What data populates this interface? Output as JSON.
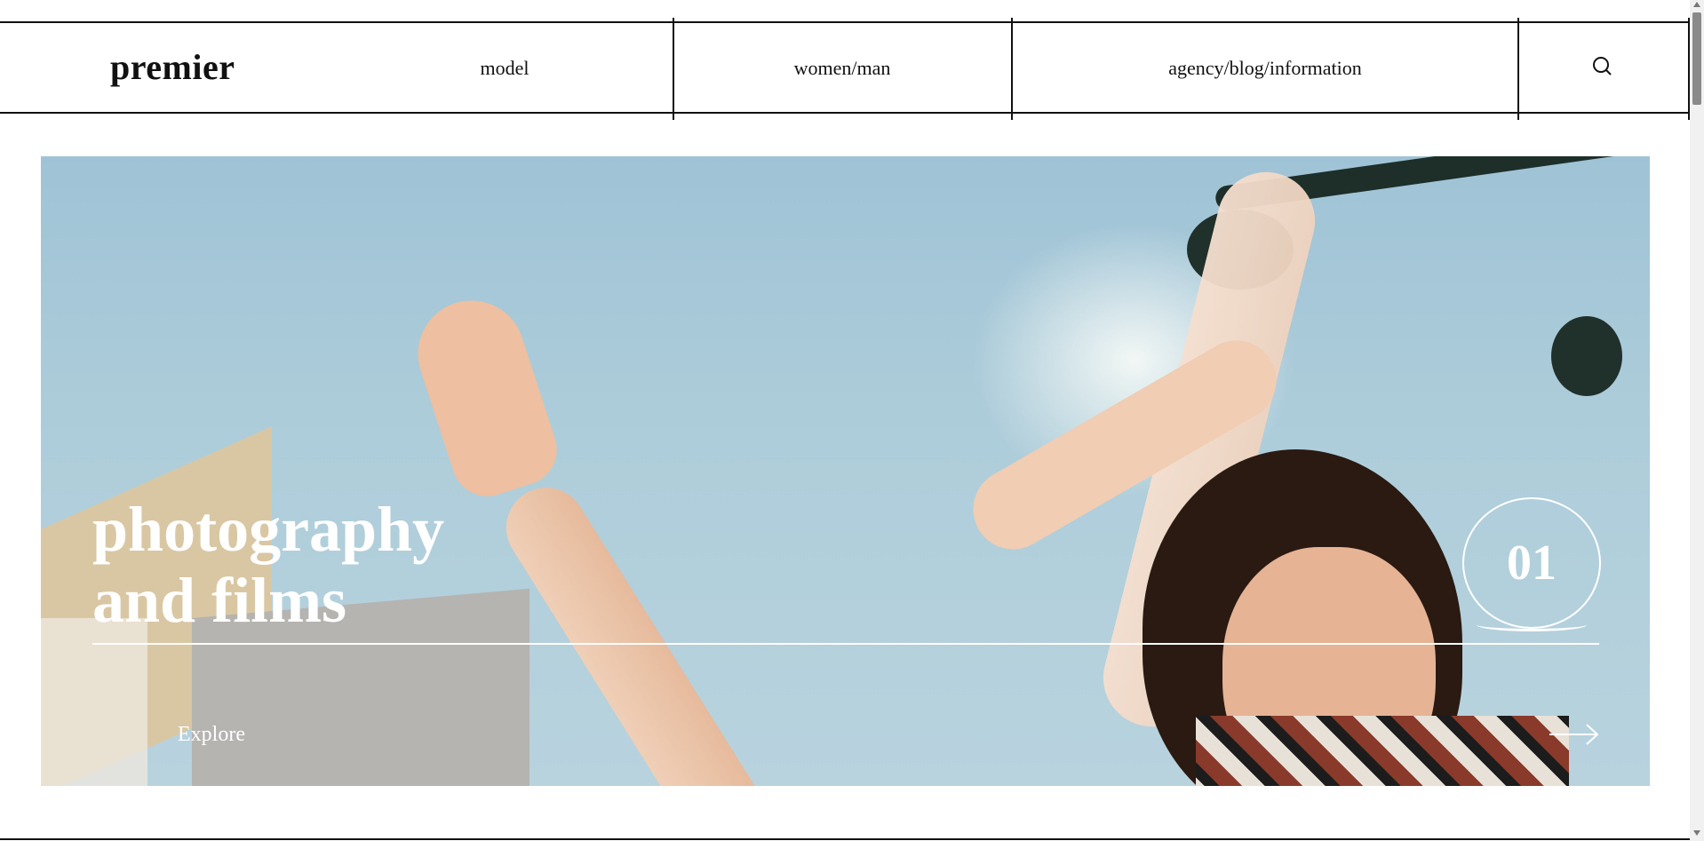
{
  "header": {
    "logo": "premier",
    "nav": [
      {
        "label": "model"
      },
      {
        "label": "women/man"
      },
      {
        "label": "agency/blog/information"
      }
    ],
    "search_icon": "search-icon"
  },
  "hero": {
    "title": "photography\nand films",
    "slide_number": "01",
    "cta_label": "Explore",
    "cta_icon": "arrow-right-icon",
    "text_color": "#ffffff"
  },
  "colors": {
    "background": "#ffffff",
    "lines": "#111111",
    "sky": "#a9cbdb"
  }
}
